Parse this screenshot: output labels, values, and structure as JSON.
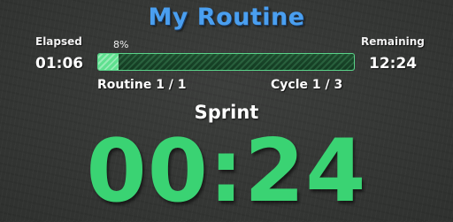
{
  "title": "My Routine",
  "elapsed": {
    "label": "Elapsed",
    "time": "01:06"
  },
  "remaining": {
    "label": "Remaining",
    "time": "12:24"
  },
  "progress": {
    "percent_label": "8%",
    "value": 0.08
  },
  "routine": {
    "text": "Routine 1 / 1"
  },
  "cycle": {
    "text": "Cycle 1 / 3"
  },
  "current_step": {
    "name": "Sprint",
    "time": "00:24"
  },
  "colors": {
    "title": "#4a9ff0",
    "timer": "#3ad373",
    "progress_fill": "#5fe08f"
  }
}
